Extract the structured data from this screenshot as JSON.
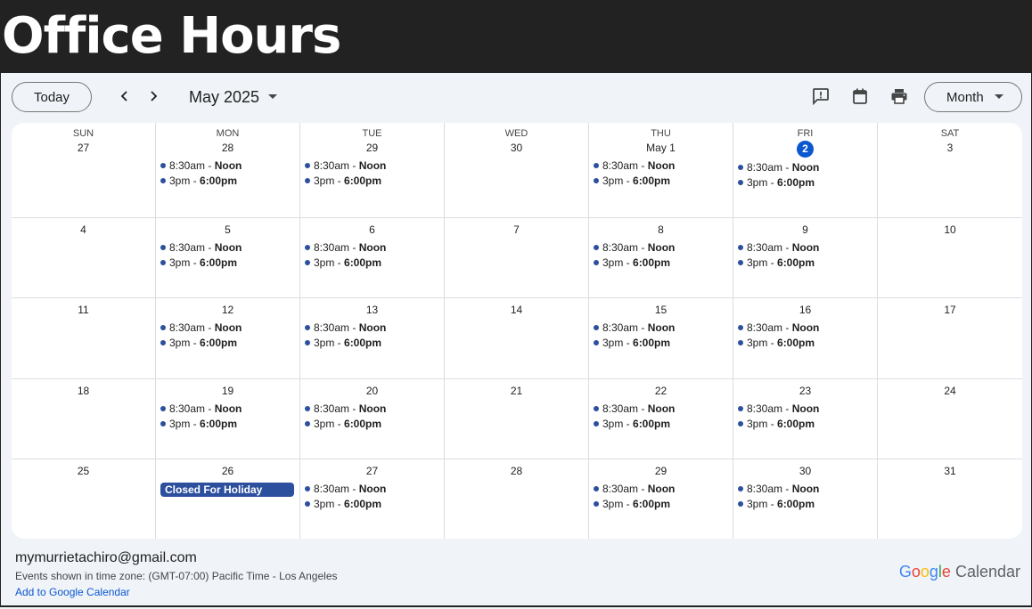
{
  "page": {
    "title": "Office Hours"
  },
  "toolbar": {
    "today_label": "Today",
    "month_label": "May 2025",
    "view_label": "Month",
    "icons": [
      "chevron-left-icon",
      "chevron-right-icon",
      "feedback-icon",
      "calendar-icon",
      "print-icon",
      "caret-down-icon"
    ]
  },
  "calendar": {
    "weekdays": [
      "SUN",
      "MON",
      "TUE",
      "WED",
      "THU",
      "FRI",
      "SAT"
    ],
    "today_date": "2",
    "accent_color": "#2c4f9e",
    "today_color": "#0b57d0",
    "weeks": [
      [
        {
          "date": "27",
          "events": []
        },
        {
          "date": "28",
          "events": [
            {
              "start": "8:30am",
              "end": "Noon"
            },
            {
              "start": "3pm",
              "end": "6:00pm"
            }
          ]
        },
        {
          "date": "29",
          "events": [
            {
              "start": "8:30am",
              "end": "Noon"
            },
            {
              "start": "3pm",
              "end": "6:00pm"
            }
          ]
        },
        {
          "date": "30",
          "events": []
        },
        {
          "date": "May 1",
          "events": [
            {
              "start": "8:30am",
              "end": "Noon"
            },
            {
              "start": "3pm",
              "end": "6:00pm"
            }
          ]
        },
        {
          "date": "2",
          "today": true,
          "events": [
            {
              "start": "8:30am",
              "end": "Noon"
            },
            {
              "start": "3pm",
              "end": "6:00pm"
            }
          ]
        },
        {
          "date": "3",
          "events": []
        }
      ],
      [
        {
          "date": "4",
          "events": []
        },
        {
          "date": "5",
          "events": [
            {
              "start": "8:30am",
              "end": "Noon"
            },
            {
              "start": "3pm",
              "end": "6:00pm"
            }
          ]
        },
        {
          "date": "6",
          "events": [
            {
              "start": "8:30am",
              "end": "Noon"
            },
            {
              "start": "3pm",
              "end": "6:00pm"
            }
          ]
        },
        {
          "date": "7",
          "events": []
        },
        {
          "date": "8",
          "events": [
            {
              "start": "8:30am",
              "end": "Noon"
            },
            {
              "start": "3pm",
              "end": "6:00pm"
            }
          ]
        },
        {
          "date": "9",
          "events": [
            {
              "start": "8:30am",
              "end": "Noon"
            },
            {
              "start": "3pm",
              "end": "6:00pm"
            }
          ]
        },
        {
          "date": "10",
          "events": []
        }
      ],
      [
        {
          "date": "11",
          "events": []
        },
        {
          "date": "12",
          "events": [
            {
              "start": "8:30am",
              "end": "Noon"
            },
            {
              "start": "3pm",
              "end": "6:00pm"
            }
          ]
        },
        {
          "date": "13",
          "events": [
            {
              "start": "8:30am",
              "end": "Noon"
            },
            {
              "start": "3pm",
              "end": "6:00pm"
            }
          ]
        },
        {
          "date": "14",
          "events": []
        },
        {
          "date": "15",
          "events": [
            {
              "start": "8:30am",
              "end": "Noon"
            },
            {
              "start": "3pm",
              "end": "6:00pm"
            }
          ]
        },
        {
          "date": "16",
          "events": [
            {
              "start": "8:30am",
              "end": "Noon"
            },
            {
              "start": "3pm",
              "end": "6:00pm"
            }
          ]
        },
        {
          "date": "17",
          "events": []
        }
      ],
      [
        {
          "date": "18",
          "events": []
        },
        {
          "date": "19",
          "events": [
            {
              "start": "8:30am",
              "end": "Noon"
            },
            {
              "start": "3pm",
              "end": "6:00pm"
            }
          ]
        },
        {
          "date": "20",
          "events": [
            {
              "start": "8:30am",
              "end": "Noon"
            },
            {
              "start": "3pm",
              "end": "6:00pm"
            }
          ]
        },
        {
          "date": "21",
          "events": []
        },
        {
          "date": "22",
          "events": [
            {
              "start": "8:30am",
              "end": "Noon"
            },
            {
              "start": "3pm",
              "end": "6:00pm"
            }
          ]
        },
        {
          "date": "23",
          "events": [
            {
              "start": "8:30am",
              "end": "Noon"
            },
            {
              "start": "3pm",
              "end": "6:00pm"
            }
          ]
        },
        {
          "date": "24",
          "events": []
        }
      ],
      [
        {
          "date": "25",
          "events": []
        },
        {
          "date": "26",
          "allday": "Closed For Holiday",
          "events": []
        },
        {
          "date": "27",
          "events": [
            {
              "start": "8:30am",
              "end": "Noon"
            },
            {
              "start": "3pm",
              "end": "6:00pm"
            }
          ]
        },
        {
          "date": "28",
          "events": []
        },
        {
          "date": "29",
          "events": [
            {
              "start": "8:30am",
              "end": "Noon"
            },
            {
              "start": "3pm",
              "end": "6:00pm"
            }
          ]
        },
        {
          "date": "30",
          "events": [
            {
              "start": "8:30am",
              "end": "Noon"
            },
            {
              "start": "3pm",
              "end": "6:00pm"
            }
          ]
        },
        {
          "date": "31",
          "events": []
        }
      ]
    ]
  },
  "footer": {
    "owner": "mymurrietachiro@gmail.com",
    "timezone": "Events shown in time zone: (GMT-07:00) Pacific Time - Los Angeles",
    "add_link": "Add to Google Calendar",
    "brand_google": "Google",
    "brand_calendar": "Calendar"
  }
}
